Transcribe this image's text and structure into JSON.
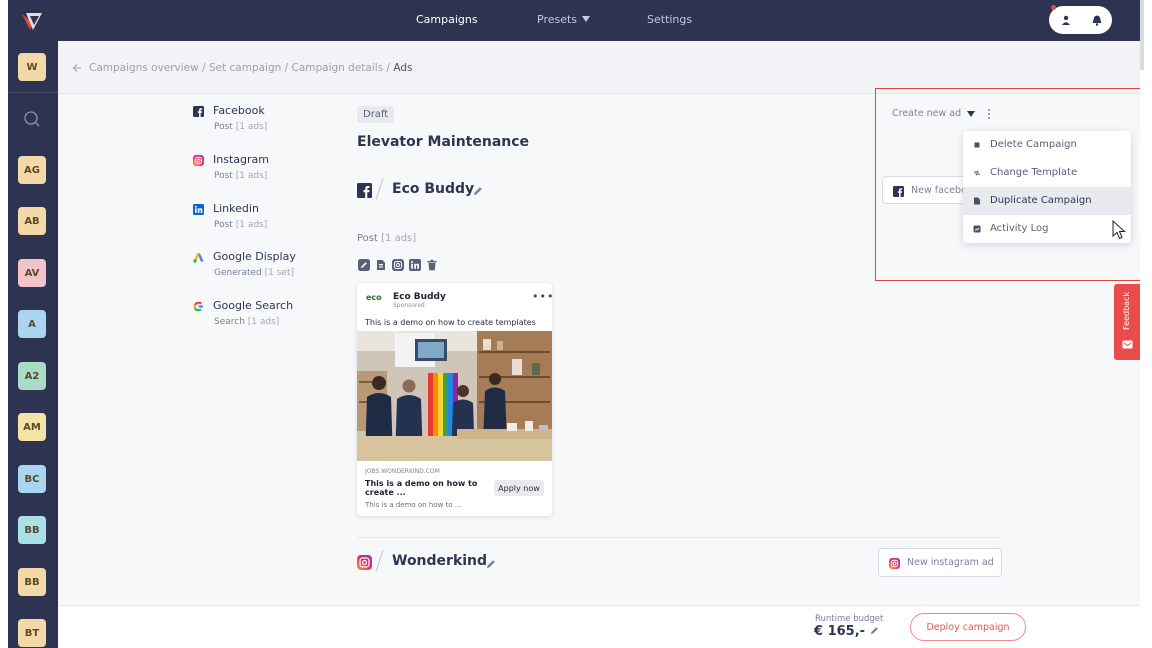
{
  "nav": {
    "items": [
      {
        "label": "Campaigns"
      },
      {
        "label": "Presets"
      },
      {
        "label": "Settings"
      }
    ]
  },
  "rail": {
    "top_chip": "W",
    "chips": [
      "AG",
      "AB",
      "AV",
      "A",
      "A2",
      "AM",
      "BC",
      "BB",
      "BB",
      "BT"
    ],
    "chip_colors": [
      "#f3d9a8",
      "#f3d9a8",
      "#f2c4c9",
      "#a9d5ee",
      "#a9dcc6",
      "#f3e3a4",
      "#a9d5ee",
      "#a9e0e8",
      "#f3d9a8",
      "#f3d9a8"
    ]
  },
  "breadcrumb": {
    "path": "Campaigns overview / Set campaign / Campaign details / ",
    "current": "Ads"
  },
  "channels": [
    {
      "name": "Facebook",
      "type": "Post",
      "count": "[1 ads]",
      "icon": "facebook-icon"
    },
    {
      "name": "Instagram",
      "type": "Post",
      "count": "[1 ads]",
      "icon": "instagram-icon"
    },
    {
      "name": "Linkedin",
      "type": "Post",
      "count": "[1 ads]",
      "icon": "linkedin-icon"
    },
    {
      "name": "Google Display",
      "type": "Generated",
      "count": "[1 set]",
      "icon": "google-display-icon"
    },
    {
      "name": "Google Search",
      "type": "Search",
      "count": "[1 ads]",
      "icon": "google-icon"
    }
  ],
  "campaign": {
    "status": "Draft",
    "title": "Elevator Maintenance"
  },
  "facebook_section": {
    "name": "Eco Buddy",
    "post_label": "Post",
    "post_count": "[1 ads]",
    "new_ad_label": "New facebook ad"
  },
  "ad_card": {
    "brand_logo": "eco",
    "brand": "Eco Buddy",
    "sponsored": "Sponsored",
    "caption": "This is a demo on how to create templates",
    "domain": "JOBS.WONDERKIND.COM",
    "headline": "This is a demo on how to create ...",
    "description": "This is a demo on how to ...",
    "cta": "Apply now"
  },
  "instagram_section": {
    "name": "Wonderkind",
    "new_ad_label": "New instagram ad"
  },
  "create_new": {
    "label": "Create new ad"
  },
  "menu": {
    "items": [
      {
        "label": "Delete Campaign",
        "icon": "square-icon"
      },
      {
        "label": "Change Template",
        "icon": "swap-icon"
      },
      {
        "label": "Duplicate Campaign",
        "icon": "duplicate-icon"
      },
      {
        "label": "Activity Log",
        "icon": "activity-log-icon"
      }
    ],
    "hovered_index": 2
  },
  "feedback": {
    "label": "Feedback"
  },
  "footer": {
    "budget_label": "Runtime budget",
    "budget_value": "€ 165,-",
    "deploy_label": "Deploy campaign"
  },
  "colors": {
    "nav_bg": "#2d3350",
    "accent_red": "#e05a5a",
    "highlight_border": "#e0453a"
  }
}
